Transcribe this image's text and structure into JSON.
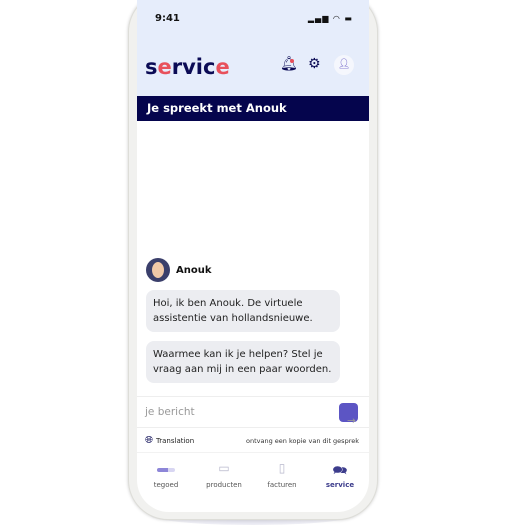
{
  "status": {
    "time": "9:41",
    "icons": "signal-wifi-battery"
  },
  "header": {
    "logo": "service",
    "logo_colors": {
      "main": "#0b0b55",
      "accent": "#e8505b"
    },
    "icons": [
      "bell-icon",
      "gear-icon",
      "user-icon"
    ]
  },
  "chat": {
    "title": "Je spreekt met Anouk",
    "agent": "Anouk",
    "messages": [
      "Hoi, ik ben Anouk. De virtuele assistentie van hollandsnieuwe.",
      "Waarmee kan ik je helpen? Stel je vraag aan mij in een paar woorden."
    ]
  },
  "input": {
    "placeholder": "je bericht"
  },
  "footer": {
    "translation": "Translation",
    "copy": "ontvang een kopie van dit gesprek"
  },
  "nav": [
    {
      "label": "tegoed"
    },
    {
      "label": "producten"
    },
    {
      "label": "facturen"
    },
    {
      "label": "service",
      "active": true
    }
  ],
  "accent": "#5c55c4",
  "bar_color": "#05054d"
}
